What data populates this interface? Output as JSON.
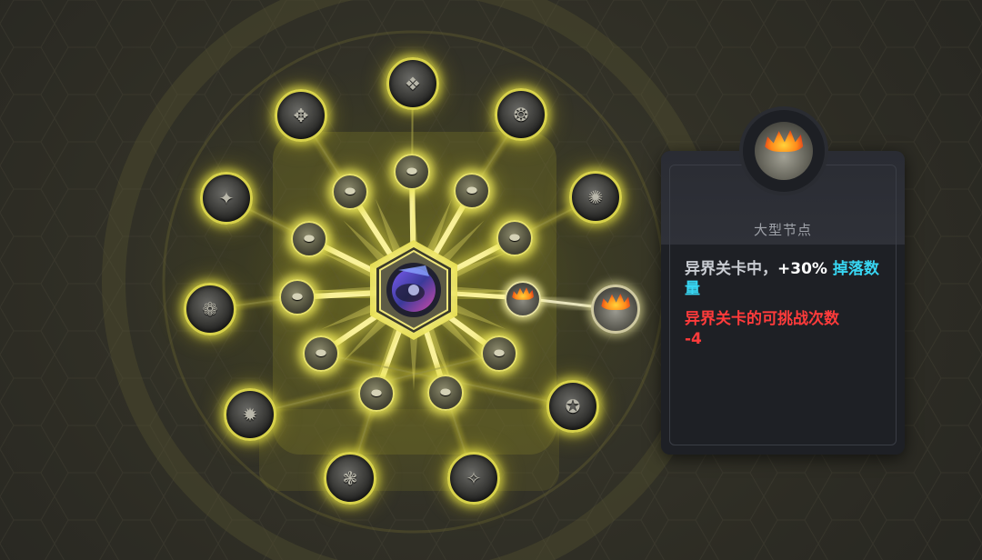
{
  "tooltip": {
    "title": "大型节点",
    "effect_prefix": "异界关卡中，",
    "effect_value": "+30%",
    "effect_highlight": "掉落数量",
    "penalty_text": "异界关卡的可挑战次数",
    "penalty_value": "-4",
    "node_icon": "treasure-pot-icon"
  },
  "center_node": {
    "icon": "blue-gem-relic-icon"
  },
  "outer_ring_icons": [
    "beast-emblem-icon",
    "lion-crest-icon",
    "ring-crest-icon",
    "dragon-crest-icon",
    "pot-emblem-icon",
    "wreath-emblem-icon",
    "mask-emblem-icon",
    "shell-emblem-icon",
    "helmet-emblem-icon",
    "dragon-crest-icon",
    "ram-crest-icon",
    "wolf-crest-icon"
  ],
  "inner_ring_icons": [
    "small-pot-icon",
    "small-pot-icon",
    "small-pot-icon",
    "small-pot-icon",
    "small-pot-icon",
    "small-pot-icon",
    "small-pot-icon",
    "small-pot-icon",
    "small-pot-icon",
    "small-pot-icon",
    "small-pot-icon",
    "small-pot-icon"
  ],
  "colors": {
    "glow": "#e9e24a",
    "highlight_cyan": "#38d6f2",
    "penalty_red": "#ff3b3b",
    "panel_bg": "#23252b"
  }
}
